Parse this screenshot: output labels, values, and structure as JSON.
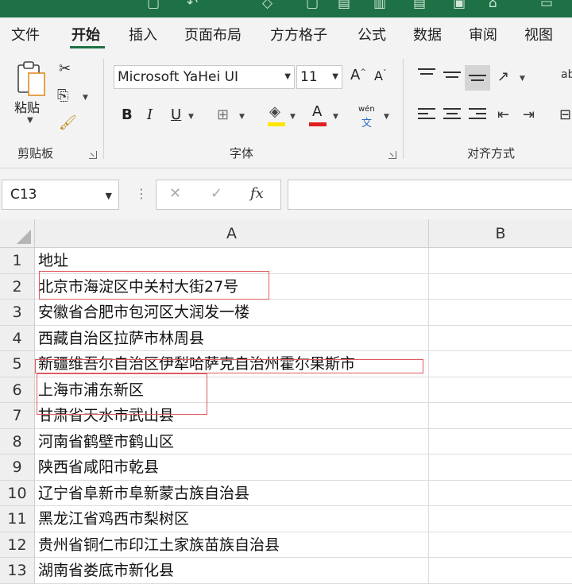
{
  "ribbon_tabs": [
    "文件",
    "开始",
    "插入",
    "页面布局",
    "方方格子",
    "公式",
    "数据",
    "审阅",
    "视图"
  ],
  "active_tab": "开始",
  "clipboard": {
    "paste_label": "粘贴",
    "group_label": "剪贴板"
  },
  "font": {
    "name": "Microsoft YaHei UI",
    "size": "11",
    "grow": "A",
    "shrink": "A",
    "bold": "B",
    "italic": "I",
    "underline": "U",
    "font_color_letter": "A",
    "phonetic_top": "wén",
    "phonetic_bottom": "文",
    "group_label": "字体"
  },
  "alignment": {
    "group_label": "对齐方式"
  },
  "formula_bar": {
    "name_box": "C13",
    "cancel": "✕",
    "enter": "✓",
    "fx": "fx",
    "value": ""
  },
  "columns": [
    "A",
    "B"
  ],
  "rows": [
    {
      "num": "1",
      "a": "地址"
    },
    {
      "num": "2",
      "a": "北京市海淀区中关村大街27号"
    },
    {
      "num": "3",
      "a": "安徽省合肥市包河区大润发一楼"
    },
    {
      "num": "4",
      "a": "西藏自治区拉萨市林周县"
    },
    {
      "num": "5",
      "a": "新疆维吾尔自治区伊犁哈萨克自治州霍尔果斯市"
    },
    {
      "num": "6",
      "a": "上海市浦东新区"
    },
    {
      "num": "7",
      "a": "甘肃省天水市武山县"
    },
    {
      "num": "8",
      "a": "河南省鹤壁市鹤山区"
    },
    {
      "num": "9",
      "a": "陕西省咸阳市乾县"
    },
    {
      "num": "10",
      "a": "辽宁省阜新市阜新蒙古族自治县"
    },
    {
      "num": "11",
      "a": "黑龙江省鸡西市梨树区"
    },
    {
      "num": "12",
      "a": "贵州省铜仁市印江土家族苗族自治县"
    },
    {
      "num": "13",
      "a": "湖南省娄底市新化县"
    }
  ],
  "colors": {
    "accent": "#1e7145",
    "highlight_mark": "#e05a60",
    "fill_yellow": "#ffe600",
    "font_red": "#e02020"
  }
}
